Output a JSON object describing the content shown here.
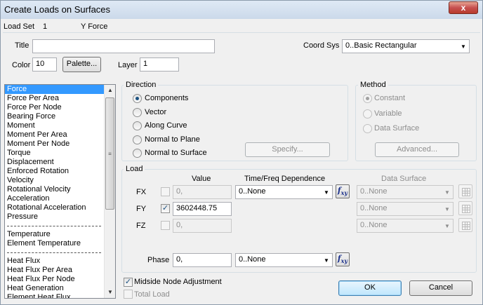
{
  "window": {
    "title": "Create Loads on Surfaces",
    "close_label": "x"
  },
  "header": {
    "load_set_label": "Load Set",
    "load_set_value": "1",
    "load_set_name": "Y Force"
  },
  "form": {
    "title_label": "Title",
    "title_value": "",
    "coord_sys_label": "Coord Sys",
    "coord_sys_value": "0..Basic Rectangular",
    "color_label": "Color",
    "color_value": "10",
    "palette_button": "Palette...",
    "layer_label": "Layer",
    "layer_value": "1"
  },
  "load_types": {
    "items_a": [
      "Force",
      "Force Per Area",
      "Force Per Node",
      "Bearing Force",
      "Moment",
      "Moment Per Area",
      "Moment Per Node",
      "Torque",
      "Displacement",
      "Enforced Rotation",
      "Velocity",
      "Rotational Velocity",
      "Acceleration",
      "Rotational Acceleration",
      "Pressure"
    ],
    "items_b": [
      "Temperature",
      "Element Temperature"
    ],
    "items_c": [
      "Heat Flux",
      "Heat Flux Per Area",
      "Heat Flux Per Node",
      "Heat Generation",
      "Element Heat Flux"
    ],
    "selected": "Force"
  },
  "direction": {
    "title": "Direction",
    "options": [
      "Components",
      "Vector",
      "Along Curve",
      "Normal to Plane",
      "Normal to Surface"
    ],
    "selected_index": 0,
    "specify_button": "Specify..."
  },
  "method": {
    "title": "Method",
    "options": [
      "Constant",
      "Variable",
      "Data Surface"
    ],
    "selected_index": 0,
    "advanced_button": "Advanced..."
  },
  "load": {
    "title": "Load",
    "col_value": "Value",
    "col_time": "Time/Freq Dependence",
    "col_surface": "Data Surface",
    "rows": [
      {
        "label": "FX",
        "checked": false,
        "value": "0,",
        "time": "0..None",
        "surface": "0..None"
      },
      {
        "label": "FY",
        "checked": true,
        "value": "3602448.75",
        "time": "",
        "surface": "0..None"
      },
      {
        "label": "FZ",
        "checked": false,
        "value": "0,",
        "time": "",
        "surface": "0..None"
      }
    ],
    "phase_label": "Phase",
    "phase_value": "0,",
    "phase_time": "0..None",
    "fxy_label": "f",
    "fxy_sub": "xy"
  },
  "footer": {
    "midside_label": "Midside Node Adjustment",
    "midside_checked": true,
    "total_load_label": "Total Load",
    "total_load_checked": false,
    "ok_button": "OK",
    "cancel_button": "Cancel"
  },
  "glyphs": {
    "check": "✓",
    "dropdown": "▼",
    "up": "▲",
    "down": "▼",
    "grip": "≡"
  }
}
